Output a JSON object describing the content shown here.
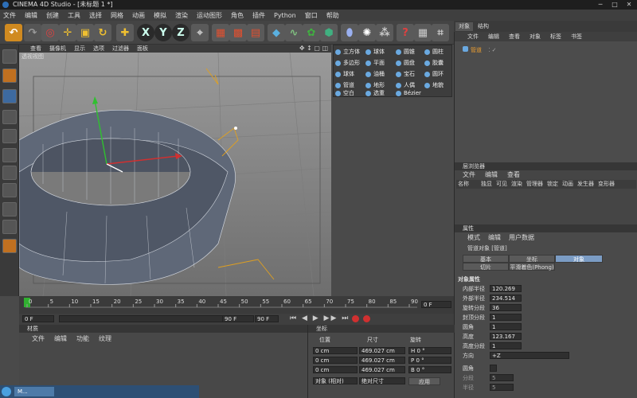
{
  "window": {
    "title": "CINEMA 4D Studio - [未标题 1 *]"
  },
  "menubar": [
    "文件",
    "编辑",
    "创建",
    "工具",
    "选择",
    "网格",
    "动画",
    "模拟",
    "渲染",
    "运动图形",
    "角色",
    "插件",
    "Python",
    "窗口",
    "帮助"
  ],
  "toolbar": {
    "icons": [
      "undo-icon",
      "redo-icon",
      "select-icon",
      "move-icon",
      "scale-icon",
      "rotate-icon",
      "snap-icon",
      "x-axis-icon",
      "y-axis-icon",
      "z-axis-icon",
      "coord-icon",
      "render-view-icon",
      "render-picture-icon",
      "render-settings-icon",
      "cube-icon",
      "spline-icon",
      "generator-icon",
      "subdivision-icon",
      "deformer-icon",
      "environment-icon",
      "camera-icon",
      "light-icon",
      "tags-icon",
      "layout-icon"
    ],
    "axis_x": "X",
    "axis_y": "Y",
    "axis_z": "Z"
  },
  "viewport": {
    "menu": [
      "查看",
      "摄像机",
      "显示",
      "选项",
      "过滤器",
      "面板"
    ],
    "label": "透视视图",
    "nav_icons": "✥ ↕ ▢ ◫"
  },
  "shape_panel": {
    "items": [
      "立方体",
      "球体",
      "圆锥",
      "圆柱",
      "多边形",
      "平面",
      "圆盘",
      "胶囊",
      "球体",
      "油桶",
      "宝石",
      "圆环",
      "管道",
      "地形",
      "人偶",
      "地貌",
      "空白",
      "选重",
      "Bézier"
    ]
  },
  "right_tabs": [
    "对象",
    "结构"
  ],
  "object_manager": {
    "menu": [
      "文件",
      "编辑",
      "查看",
      "对象",
      "标签",
      "书签"
    ],
    "objects": [
      {
        "name": "管道"
      }
    ]
  },
  "layer_browser": {
    "title": "层浏览器",
    "menu": [
      "文件",
      "编辑",
      "查看"
    ],
    "columns": [
      "名称",
      "独显",
      "可见",
      "渲染",
      "管理器",
      "锁定",
      "动画",
      "发生器",
      "变形器"
    ]
  },
  "attributes": {
    "title": "属性",
    "menu": [
      "模式",
      "编辑",
      "用户数据"
    ],
    "object_label": "管道对象 [管道]",
    "tabs": [
      "基本",
      "坐标",
      "对象",
      "切片",
      "平滑着色(Phong)"
    ],
    "section": "对象属性",
    "fields": [
      {
        "label": "内部半径",
        "value": "120.269"
      },
      {
        "label": "外部半径",
        "value": "234.514"
      },
      {
        "label": "旋转分段",
        "value": "36"
      },
      {
        "label": "封顶分段",
        "value": "1"
      },
      {
        "label": "圆角",
        "value": "1"
      },
      {
        "label": "高度",
        "value": "123.167"
      },
      {
        "label": "高度分段",
        "value": "1"
      },
      {
        "label": "方向",
        "value": "+Z"
      }
    ],
    "extra": [
      {
        "label": "圆角",
        "value": ""
      },
      {
        "label": "分段",
        "value": "5"
      },
      {
        "label": "半径",
        "value": "5"
      }
    ]
  },
  "timeline": {
    "ticks": [
      "0",
      "5",
      "10",
      "15",
      "20",
      "25",
      "30",
      "35",
      "40",
      "45",
      "50",
      "55",
      "60",
      "65",
      "70",
      "75",
      "80",
      "85",
      "90"
    ],
    "frame": "0 F",
    "start": "0 F",
    "end": "90 F",
    "max": "90 F"
  },
  "materials": {
    "title": "材质",
    "menu": [
      "文件",
      "编辑",
      "功能",
      "纹理"
    ]
  },
  "coordinates": {
    "title": "坐标",
    "headers": [
      "位置",
      "尺寸",
      "旋转"
    ],
    "rows": [
      {
        "pos": "0 cm",
        "size": "469.027 cm",
        "rot": "H 0 °"
      },
      {
        "pos": "0 cm",
        "size": "469.027 cm",
        "rot": "P 0 °"
      },
      {
        "pos": "0 cm",
        "size": "469.027 cm",
        "rot": "B 0 °"
      }
    ],
    "mode": "对象 (相对)",
    "size_mode": "绝对尺寸",
    "apply": "应用"
  },
  "taskbar": {
    "item": "M..."
  },
  "colors": {
    "accent_orange": "#e0a020",
    "accent_blue": "#2d6fb8",
    "axis_green": "#30c030",
    "axis_red": "#d03030"
  }
}
